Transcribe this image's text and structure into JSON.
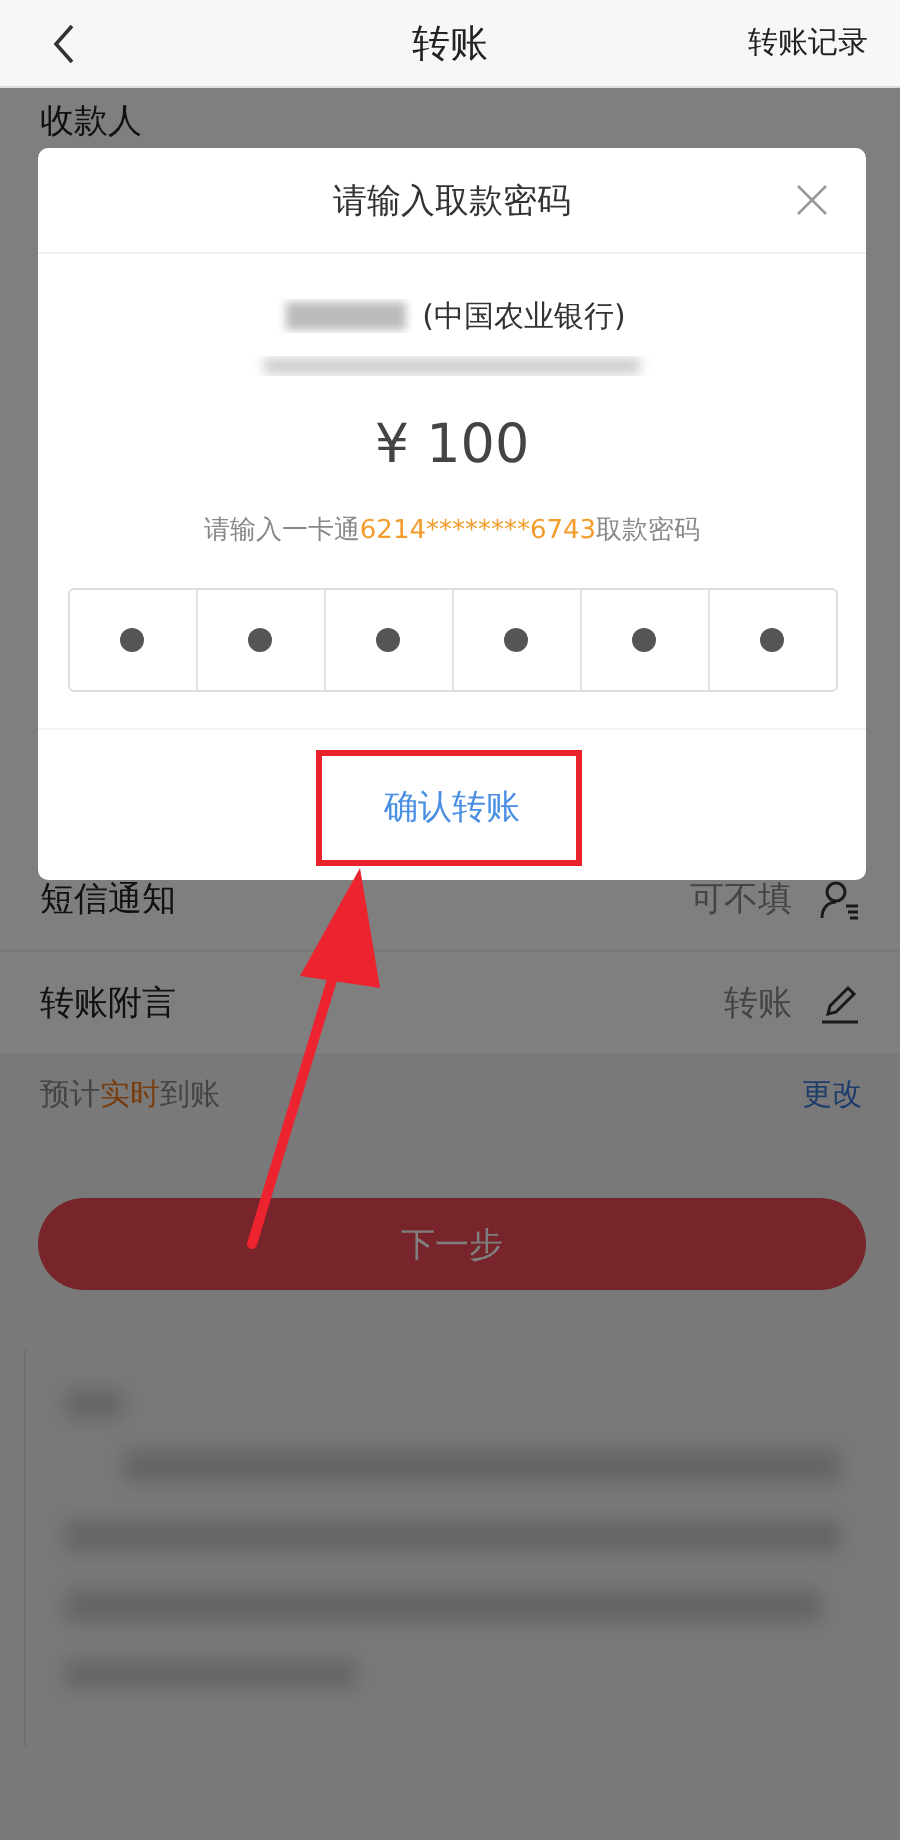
{
  "header": {
    "title": "转账",
    "right_link": "转账记录"
  },
  "recipient_label": "收款人",
  "dialog": {
    "title": "请输入取款密码",
    "bank": "(中国农业银行)",
    "amount": "¥ 100",
    "hint": [
      {
        "text": "请输入一卡通",
        "highlight": false
      },
      {
        "text": "6214********6743",
        "highlight": true
      },
      {
        "text": "取款密码",
        "highlight": false
      }
    ],
    "digits": [
      {
        "filled": true
      },
      {
        "filled": true
      },
      {
        "filled": true
      },
      {
        "filled": true
      },
      {
        "filled": true
      },
      {
        "filled": true
      }
    ],
    "confirm": "确认转账"
  },
  "rows": [
    {
      "label": "短信通知",
      "value": "可不填",
      "kind": "contact"
    },
    {
      "label": "转账附言",
      "value": "转账",
      "kind": "edit"
    }
  ],
  "arrival": [
    {
      "text": "预计",
      "highlight": false
    },
    {
      "text": "实时",
      "highlight": true
    },
    {
      "text": "到账",
      "highlight": false
    }
  ],
  "change_link": "更改",
  "next_button": "下一步"
}
